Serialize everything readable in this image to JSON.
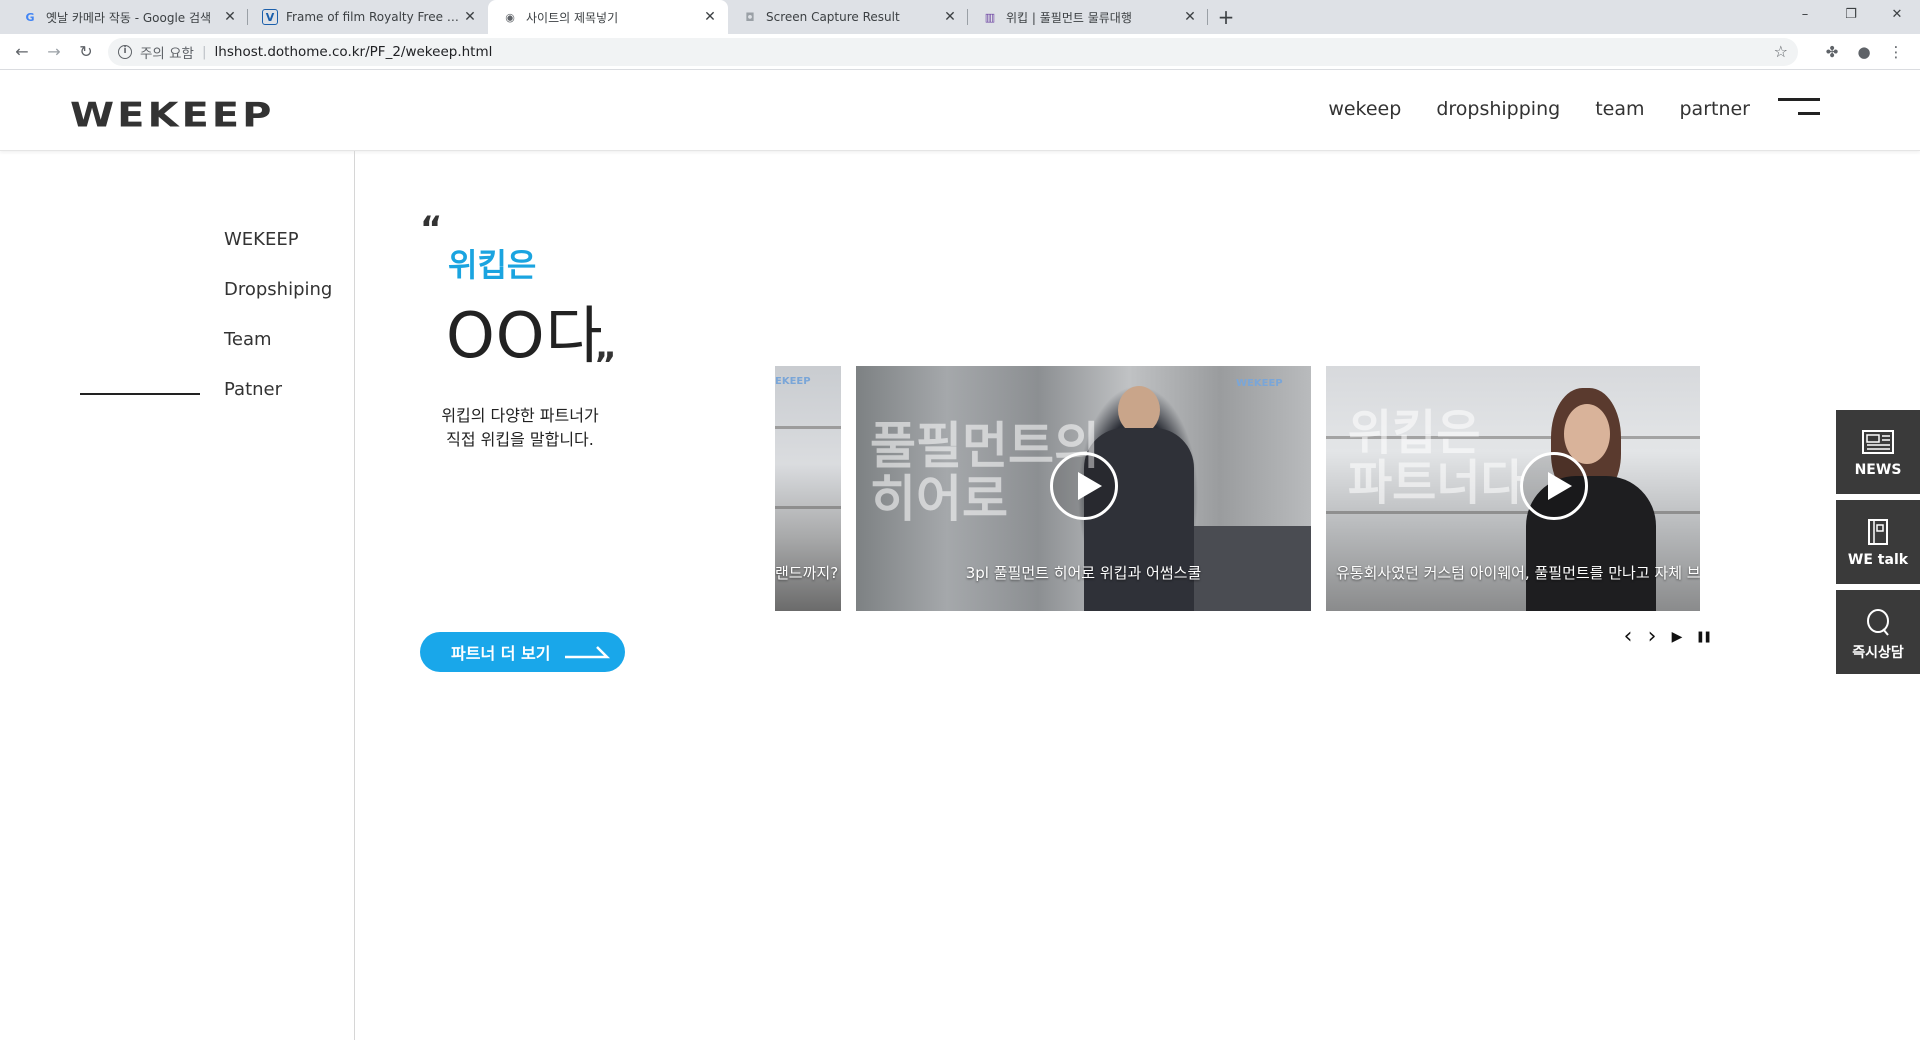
{
  "browser": {
    "tabs": [
      {
        "title": "옛날 카메라 작동 - Google 검색",
        "favicon": "G",
        "favicon_color": "#4285f4",
        "active": false
      },
      {
        "title": "Frame of film Royalty Free Vecto",
        "favicon": "V",
        "favicon_color": "#1b5fab",
        "active": false
      },
      {
        "title": "사이트의 제목넣기",
        "favicon": "◉",
        "favicon_color": "#5f6368",
        "active": true
      },
      {
        "title": "Screen Capture Result",
        "favicon": "◘",
        "favicon_color": "#9aa0a6",
        "active": false
      },
      {
        "title": "위킵 | 풀필먼트 물류대행",
        "favicon": "▥",
        "favicon_color": "#6a3fa0",
        "active": false
      }
    ],
    "new_tab": "+",
    "window_controls": {
      "minimize": "–",
      "maximize": "❐",
      "close": "✕"
    },
    "address": {
      "security_label": "주의 요함",
      "url": "lhshost.dothome.co.kr/PF_2/wekeep.html"
    }
  },
  "header": {
    "logo": "WEKEEP",
    "nav": [
      "wekeep",
      "dropshipping",
      "team",
      "partner"
    ]
  },
  "sidemenu": {
    "items": [
      "WEKEEP",
      "Dropshiping",
      "Team",
      "Patner"
    ],
    "active_index": 3
  },
  "main": {
    "quote_open": "“",
    "quote_close": "”",
    "brand": "위킵은",
    "headline": "OO다",
    "desc_lines": [
      "위킵의 다양한 파트너가",
      "직접 위킵을 말합니다."
    ],
    "more_button": "파트너 더 보기"
  },
  "slider": {
    "slides": [
      {
        "caption": "랜드까지?",
        "overlay": "",
        "mark": "EKEEP"
      },
      {
        "caption": "3pl 풀필먼트 히어로 위킵과 어썸스쿨",
        "overlay": "풀필먼트의\n히어로",
        "mark": "WEKEEP"
      },
      {
        "caption": "유통회사였던 커스텀 아이웨어, 풀필먼트를 만나고 자체 브",
        "overlay": "위킵은\n파트너다",
        "mark": ""
      }
    ],
    "controls": {
      "prev": "‹",
      "next": "›",
      "play": "▶",
      "pause": "❚❚"
    }
  },
  "quickmenu": [
    {
      "label": "NEWS",
      "icon": "news-icon"
    },
    {
      "label": "WE talk",
      "icon": "book-icon"
    },
    {
      "label": "즉시상담",
      "icon": "chat-bubble-icon"
    }
  ],
  "colors": {
    "accent": "#19a7ea",
    "brand_text": "#1aa4e0",
    "quickmenu_bg": "#3a3a3a"
  }
}
